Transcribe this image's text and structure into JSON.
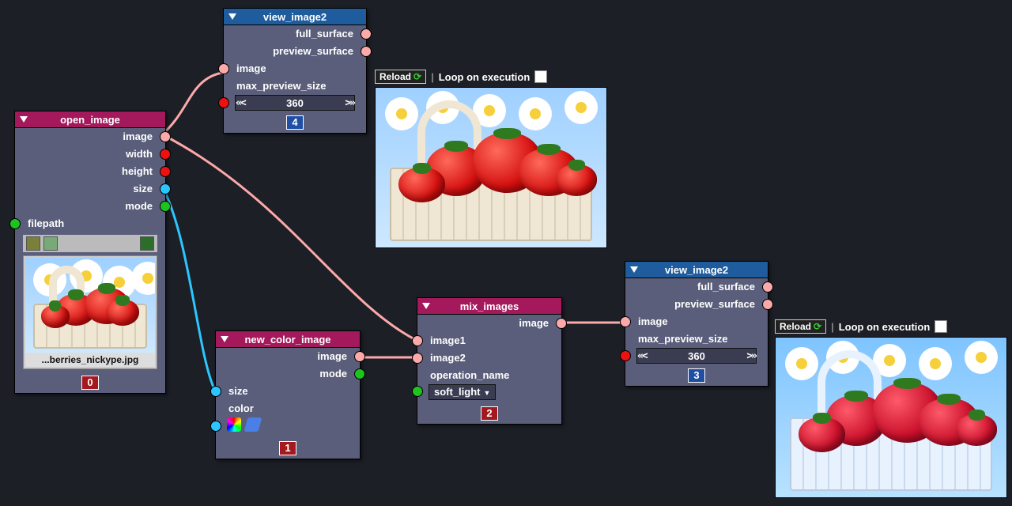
{
  "ui": {
    "reload": "Reload",
    "loop_on_execution": "Loop on execution"
  },
  "nodes": {
    "open_image": {
      "title": "open_image",
      "outputs": [
        "image",
        "width",
        "height",
        "size",
        "mode"
      ],
      "inputs": [
        "filepath"
      ],
      "filename": "...berries_nickype.jpg",
      "order": "0"
    },
    "view_top": {
      "title": "view_image2",
      "outputs": [
        "full_surface",
        "preview_surface"
      ],
      "inputs": [
        "image",
        "max_preview_size"
      ],
      "max_preview_size": "360",
      "order": "4"
    },
    "new_color": {
      "title": "new_color_image",
      "outputs": [
        "image",
        "mode"
      ],
      "inputs": [
        "size",
        "color"
      ],
      "order": "1"
    },
    "mix": {
      "title": "mix_images",
      "outputs": [
        "image"
      ],
      "inputs": [
        "image1",
        "image2",
        "operation_name"
      ],
      "operation": "soft_light",
      "order": "2"
    },
    "view_right": {
      "title": "view_image2",
      "outputs": [
        "full_surface",
        "preview_surface"
      ],
      "inputs": [
        "image",
        "max_preview_size"
      ],
      "max_preview_size": "360",
      "order": "3"
    }
  },
  "connections": [
    {
      "from": "open_image.image",
      "to": "view_top.image",
      "color": "pink"
    },
    {
      "from": "open_image.image",
      "to": "mix.image1",
      "color": "pink"
    },
    {
      "from": "open_image.size",
      "to": "new_color.size",
      "color": "cyan"
    },
    {
      "from": "new_color.image",
      "to": "mix.image2",
      "color": "pink"
    },
    {
      "from": "mix.image",
      "to": "view_right.image",
      "color": "pink"
    }
  ],
  "port_colors": {
    "image_surface": "#fca9a9",
    "int": "#e11",
    "tuple_size": "#2cc6ff",
    "string_mode": "#1ec41e"
  }
}
